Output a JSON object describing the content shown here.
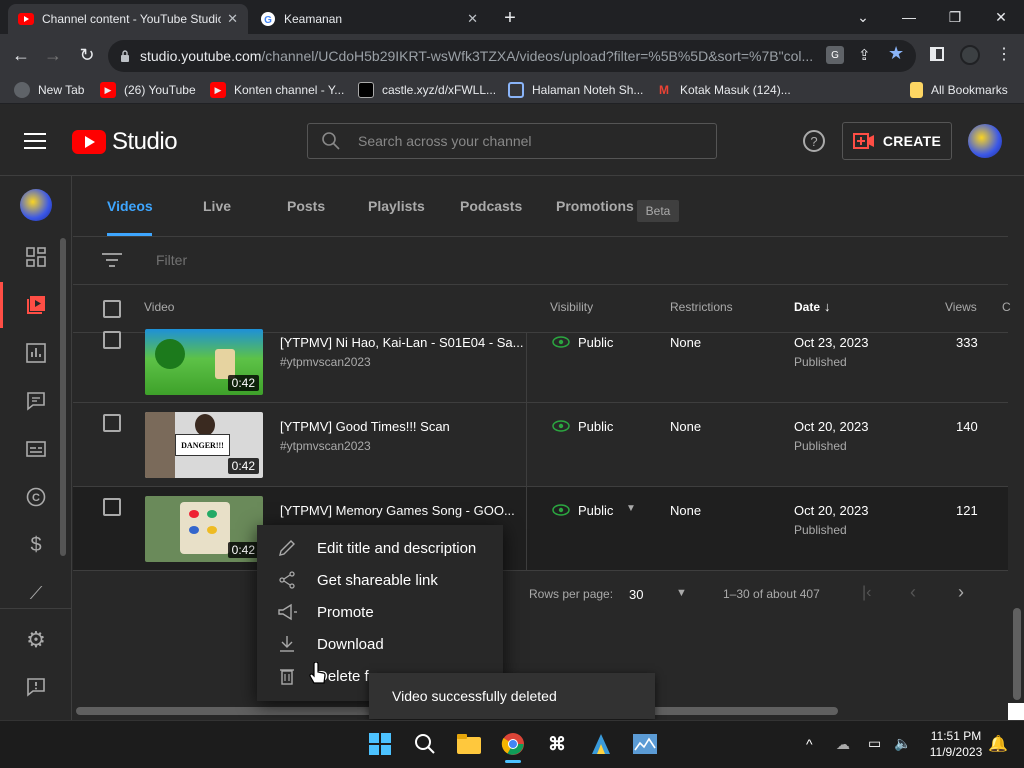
{
  "browser": {
    "tabs": [
      {
        "title": "Channel content - YouTube Studio",
        "active": true
      },
      {
        "title": "Keamanan",
        "active": false
      }
    ],
    "url_host": "studio.youtube.com",
    "url_rest": "/channel/UCdoH5b29IKRT-wsWfk3TZXA/videos/upload?filter=%5B%5D&sort=%7B\"col...",
    "bookmarks": [
      {
        "label": "New Tab",
        "icon": "globe-icon"
      },
      {
        "label": "(26) YouTube",
        "icon": "youtube-icon"
      },
      {
        "label": "Konten channel - Y...",
        "icon": "youtube-icon"
      },
      {
        "label": "castle.xyz/d/xFWLL...",
        "icon": "castle-icon"
      },
      {
        "label": "Halaman Noteh Sh...",
        "icon": "bot-icon"
      },
      {
        "label": "Kotak Masuk (124)...",
        "icon": "gmail-icon"
      }
    ],
    "all_bookmarks": "All Bookmarks"
  },
  "studio": {
    "logo_text": "Studio",
    "search_placeholder": "Search across your channel",
    "create_label": "CREATE"
  },
  "tabs": [
    {
      "label": "Videos",
      "active": true
    },
    {
      "label": "Live"
    },
    {
      "label": "Posts"
    },
    {
      "label": "Playlists"
    },
    {
      "label": "Podcasts"
    },
    {
      "label": "Promotions"
    }
  ],
  "beta_label": "Beta",
  "filter_placeholder": "Filter",
  "table": {
    "headers": {
      "video": "Video",
      "visibility": "Visibility",
      "restrictions": "Restrictions",
      "date": "Date",
      "views": "Views",
      "comments_partial": "C"
    },
    "rows": [
      {
        "title": "[YTPMV] Ni Hao, Kai-Lan - S01E04 - Sa...",
        "desc": "#ytpmvscan2023",
        "duration": "0:42",
        "visibility": "Public",
        "restrictions": "None",
        "date": "Oct 23, 2023",
        "status": "Published",
        "views": "333"
      },
      {
        "title": "[YTPMV] Good Times!!! Scan",
        "desc": "#ytpmvscan2023",
        "duration": "0:42",
        "visibility": "Public",
        "restrictions": "None",
        "date": "Oct 20, 2023",
        "status": "Published",
        "views": "140"
      },
      {
        "title": "[YTPMV] Memory Games Song - GOO...",
        "desc": "",
        "duration": "0:42",
        "visibility": "Public",
        "restrictions": "None",
        "date": "Oct 20, 2023",
        "status": "Published",
        "views": "121"
      }
    ]
  },
  "pagination": {
    "rows_per_page_label": "Rows per page:",
    "rows_per_page": "30",
    "range": "1–30 of about 407"
  },
  "context_menu": [
    {
      "label": "Edit title and description",
      "icon": "pencil-icon"
    },
    {
      "label": "Get shareable link",
      "icon": "share-icon"
    },
    {
      "label": "Promote",
      "icon": "megaphone-icon"
    },
    {
      "label": "Download",
      "icon": "download-icon"
    },
    {
      "label": "Delete f",
      "icon": "trash-icon"
    }
  ],
  "toast": "Video successfully deleted",
  "thumb_texts": {
    "danger": "DANGER!!!"
  },
  "clock": {
    "time": "11:51 PM",
    "date": "11/9/2023"
  },
  "colors": {
    "accent": "#3ea6ff",
    "youtube_red": "#ff0000",
    "create_red": "#ff4e45"
  }
}
